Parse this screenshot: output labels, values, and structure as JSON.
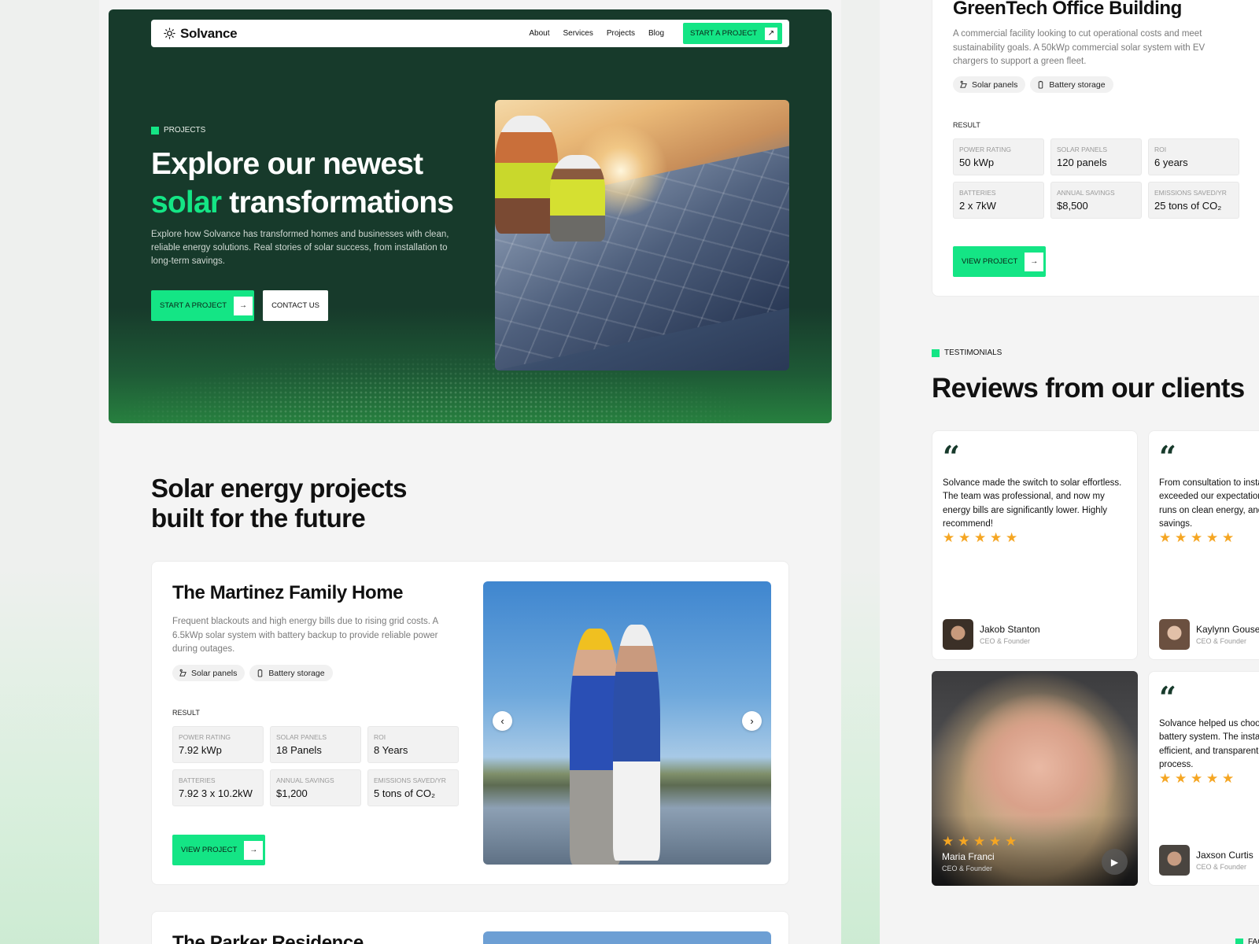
{
  "hero": {
    "logo": "Solvance",
    "nav": [
      "About",
      "Services",
      "Projects",
      "Blog"
    ],
    "nav_cta": "START A PROJECT",
    "tag": "PROJECTS",
    "title_line1": "Explore our newest",
    "title_accent": "solar",
    "title_rest": " transformations",
    "description": "Explore how Solvance has transformed homes and businesses with clean, reliable energy solutions. Real stories of solar success, from installation to long-term savings.",
    "btn_primary": "START A PROJECT",
    "btn_secondary": "CONTACT US"
  },
  "projects_section": {
    "title": "Solar energy projects built for the future",
    "card1": {
      "name": "The Martinez Family Home",
      "description": "Frequent blackouts and high energy bills due to rising grid costs. A 6.5kWp solar system with battery backup to provide reliable power during outages.",
      "chips": [
        "Solar panels",
        "Battery storage"
      ],
      "result_label": "RESULT",
      "stats": [
        {
          "label": "POWER RATING",
          "value": "7.92 kWp"
        },
        {
          "label": "SOLAR PANELS",
          "value": "18 Panels"
        },
        {
          "label": "ROI",
          "value": "8 Years"
        },
        {
          "label": "BATTERIES",
          "value": "7.92 3 x 10.2kW"
        },
        {
          "label": "ANNUAL SAVINGS",
          "value": "$1,200"
        },
        {
          "label": "EMISSIONS SAVED/YR",
          "value": "5 tons of CO₂"
        }
      ],
      "view_btn": "VIEW PROJECT"
    },
    "card2": {
      "name": "The Parker Residence"
    }
  },
  "greentech": {
    "name": "GreenTech Office Building",
    "description": "A commercial facility looking to cut operational costs and meet sustainability goals. A 50kWp commercial solar system with EV chargers to support a green fleet.",
    "chips": [
      "Solar panels",
      "Battery storage"
    ],
    "result_label": "RESULT",
    "stats": [
      {
        "label": "POWER RATING",
        "value": "50 kWp"
      },
      {
        "label": "SOLAR PANELS",
        "value": "120 panels"
      },
      {
        "label": "ROI",
        "value": "6 years"
      },
      {
        "label": "BATTERIES",
        "value": "2 x 7kW"
      },
      {
        "label": "ANNUAL SAVINGS",
        "value": "$8,500"
      },
      {
        "label": "EMISSIONS SAVED/YR",
        "value": "25 tons of CO₂"
      }
    ],
    "view_btn": "VIEW PROJECT"
  },
  "testimonials": {
    "tag": "TESTIMONIALS",
    "title": "Reviews from our clients",
    "quote_mark": "“",
    "reviews": [
      {
        "text": "Solvance made the switch to solar effortless. The team was professional, and now my energy bills are significantly lower. Highly recommend!",
        "name": "Jakob Stanton",
        "role": "CEO & Founder",
        "rating": 5
      },
      {
        "text": "From consultation to installation, Solvance exceeded our expectations. Our business now runs on clean energy, and we're seeing major savings.",
        "name": "Kaylynn Gouse",
        "role": "CEO & Founder",
        "rating": 5
      },
      {
        "text": "Solvance helped us choose the right solar and battery system. The installation was quick, efficient, and transparent throughout the whole process.",
        "name": "Jaxson Curtis",
        "role": "CEO & Founder",
        "rating": 5
      }
    ],
    "video": {
      "name": "Maria Franci",
      "role": "CEO & Founder",
      "rating": 5
    }
  },
  "faq_tag": "FAQ",
  "colors": {
    "accent": "#14e585",
    "hero_bg": "#173a2b",
    "star": "#f5a623"
  }
}
